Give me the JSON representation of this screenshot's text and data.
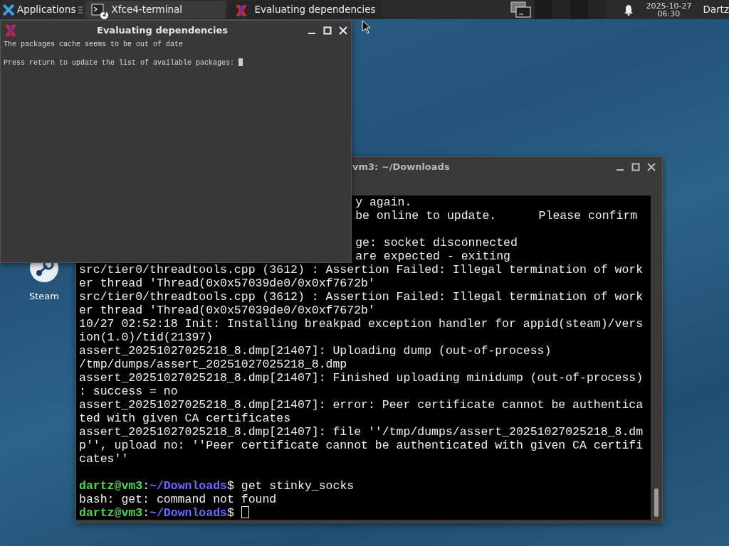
{
  "panel": {
    "apps_label": "Applications",
    "tasks": [
      {
        "label": "Xfce4-terminal",
        "kind": "terminal",
        "badge": "2",
        "selected": false
      },
      {
        "label": "Evaluating dependencies",
        "kind": "xlogo",
        "selected": true
      }
    ],
    "clock": {
      "date": "2025-10-27",
      "time": "06:30"
    },
    "user": "Dartz"
  },
  "desktop_icons": [
    {
      "label": "Steam"
    }
  ],
  "terminal": {
    "title": "vm3: ~/Downloads",
    "lines": [
      {
        "kind": "partial",
        "text": "y again."
      },
      {
        "kind": "partial",
        "text": "be online to update.      Please confirm"
      },
      {
        "kind": "blank"
      },
      {
        "kind": "partial",
        "text": "ge: socket disconnected"
      },
      {
        "kind": "partial",
        "text": "are expected - exiting"
      },
      {
        "kind": "text",
        "text": "src/tier0/threadtools.cpp (3612) : Assertion Failed: Illegal termination of work"
      },
      {
        "kind": "text",
        "text": "er thread 'Thread(0x0x57039de0/0x0xf7672b'"
      },
      {
        "kind": "text",
        "text": "src/tier0/threadtools.cpp (3612) : Assertion Failed: Illegal termination of work"
      },
      {
        "kind": "text",
        "text": "er thread 'Thread(0x0x57039de0/0x0xf7672b'"
      },
      {
        "kind": "text",
        "text": "10/27 02:52:18 Init: Installing breakpad exception handler for appid(steam)/vers"
      },
      {
        "kind": "text",
        "text": "ion(1.0)/tid(21397)"
      },
      {
        "kind": "text",
        "text": "assert_20251027025218_8.dmp[21407]: Uploading dump (out-of-process)"
      },
      {
        "kind": "text",
        "text": "/tmp/dumps/assert_20251027025218_8.dmp"
      },
      {
        "kind": "text",
        "text": "assert_20251027025218_8.dmp[21407]: Finished uploading minidump (out-of-process)"
      },
      {
        "kind": "text",
        "text": ": success = no"
      },
      {
        "kind": "text",
        "text": "assert_20251027025218_8.dmp[21407]: error: Peer certificate cannot be authentica"
      },
      {
        "kind": "text",
        "text": "ted with given CA certificates"
      },
      {
        "kind": "text",
        "text": "assert_20251027025218_8.dmp[21407]: file ''/tmp/dumps/assert_20251027025218_8.dm"
      },
      {
        "kind": "text",
        "text": "p'', upload no: ''Peer certificate cannot be authenticated with given CA certifi"
      },
      {
        "kind": "text",
        "text": "cates''"
      },
      {
        "kind": "blank"
      },
      {
        "kind": "prompt",
        "user": "dartz@vm3",
        "colon": ":",
        "path": "~/Downloads",
        "sign": "$",
        "command": "get stinky_socks"
      },
      {
        "kind": "text",
        "text": "bash: get: command not found"
      },
      {
        "kind": "prompt",
        "user": "dartz@vm3",
        "colon": ":",
        "path": "~/Downloads",
        "sign": "$"
      }
    ]
  },
  "dialog": {
    "title": "Evaluating dependencies",
    "lines": [
      {
        "kind": "text",
        "text": "The packages cache seems to be out of date"
      },
      {
        "kind": "blank"
      },
      {
        "kind": "input",
        "text": "Press return to update the list of available packages:"
      }
    ]
  }
}
